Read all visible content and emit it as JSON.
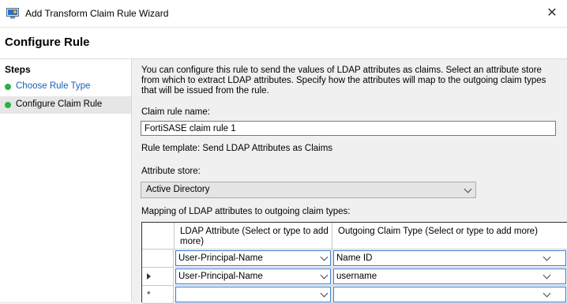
{
  "window": {
    "title": "Add Transform Claim Rule Wizard",
    "close_glyph": "✕"
  },
  "wizard": {
    "page_title": "Configure Rule"
  },
  "steps": {
    "title": "Steps",
    "items": [
      {
        "label": "Choose Rule Type",
        "state": "link"
      },
      {
        "label": "Configure Claim Rule",
        "state": "active"
      }
    ]
  },
  "content": {
    "description": "You can configure this rule to send the values of LDAP attributes as claims. Select an attribute store from which to extract LDAP attributes. Specify how the attributes will map to the outgoing claim types that will be issued from the rule.",
    "claim_rule_name_label": "Claim rule name:",
    "claim_rule_name_value": "FortiSASE claim rule 1",
    "rule_template_text": "Rule template: Send LDAP Attributes as Claims",
    "attribute_store_label": "Attribute store:",
    "attribute_store_value": "Active Directory",
    "mapping_label": "Mapping of LDAP attributes to outgoing claim types:"
  },
  "grid": {
    "columns": [
      "LDAP Attribute (Select or type to add more)",
      "Outgoing Claim Type (Select or type to add more)"
    ],
    "rows": [
      {
        "ldap": "User-Principal-Name",
        "claim": "Name ID",
        "marker": ""
      },
      {
        "ldap": "User-Principal-Name",
        "claim": "username",
        "marker": "current"
      },
      {
        "ldap": "",
        "claim": "",
        "marker": "new"
      }
    ],
    "new_row_glyph": "*"
  },
  "colors": {
    "step_dot": "#26b24a",
    "link": "#1a5fb4",
    "focus_border": "#3a78c8"
  },
  "icons": {
    "app": "admin-tools-icon"
  }
}
